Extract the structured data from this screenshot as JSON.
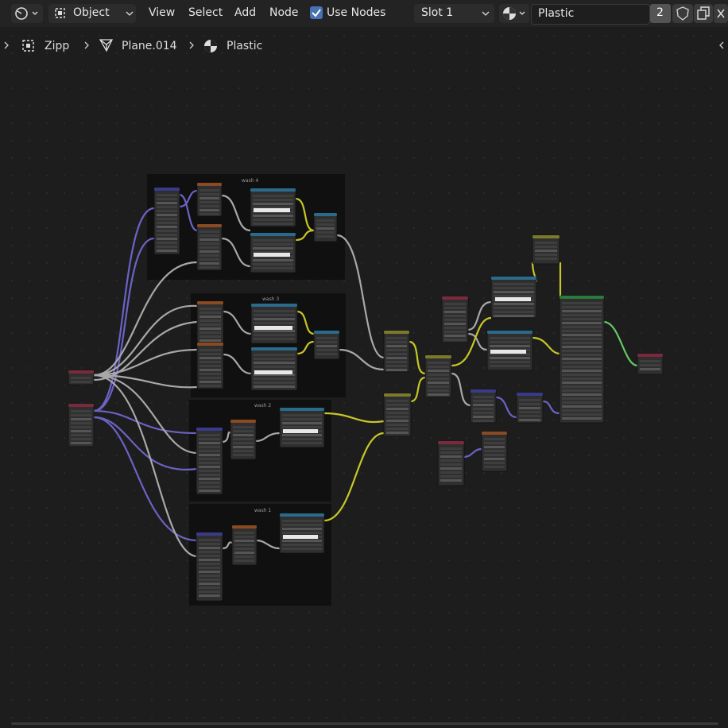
{
  "header": {
    "editor_icon": "node-editor-icon",
    "mode_label": "Object",
    "menus": [
      "View",
      "Select",
      "Add",
      "Node"
    ],
    "use_nodes_label": "Use Nodes",
    "use_nodes_checked": true,
    "slot_label": "Slot 1",
    "material_name": "Plastic",
    "user_count": "2"
  },
  "breadcrumb": {
    "object": "Zipp",
    "mesh": "Plane.014",
    "material": "Plastic"
  },
  "frames": [
    "wash 4",
    "wash 3",
    "wash 2",
    "wash 1"
  ],
  "colors": {
    "link_shader": "#6b63c4",
    "link_float": "#a8a8a8",
    "link_color": "#c6c629",
    "link_output": "#63c763",
    "node_body": "#303030",
    "frame_bg": "#0f0f0f"
  }
}
